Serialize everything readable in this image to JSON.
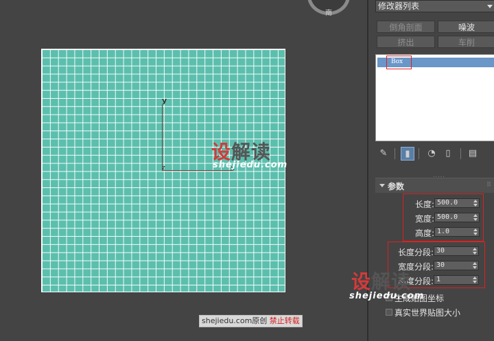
{
  "viewport": {
    "viewcube_label": "南",
    "gizmo": {
      "x": "x",
      "y": "y",
      "z": "z"
    },
    "watermark": {
      "cn": [
        "设",
        "解读"
      ],
      "en": "shejiedu.com"
    },
    "credit": {
      "site": "shejiedu.com",
      "text": "原创",
      "warning": "禁止转载"
    }
  },
  "panel": {
    "modifier_list": "修改器列表",
    "quick_buttons": [
      {
        "label": "倒角剖面",
        "enabled": false
      },
      {
        "label": "噪波",
        "enabled": true
      },
      {
        "label": "挤出",
        "enabled": false
      },
      {
        "label": "车削",
        "enabled": false
      }
    ],
    "stack": {
      "selected_item": "Box"
    },
    "toolbar_icons": [
      "pin-stack-icon",
      "show-end-result-icon",
      "make-unique-icon",
      "remove-modifier-icon",
      "configure-modifier-sets-icon"
    ],
    "parameters": {
      "title": "参数",
      "length_label": "长度:",
      "length": "500.0",
      "width_label": "宽度:",
      "width": "500.0",
      "height_label": "高度:",
      "height": "1.0",
      "length_segs_label": "长度分段:",
      "length_segs": "30",
      "width_segs_label": "宽度分段:",
      "width_segs": "30",
      "height_segs_label": "高度分段:",
      "height_segs": "1",
      "gen_map_coords": "生成贴图坐标",
      "gen_map_coords_checked": true,
      "real_world_map_size": "真实世界贴图大小",
      "real_world_map_size_checked": false
    },
    "watermark": {
      "cn": [
        "设",
        "解读"
      ],
      "en": "shejiedu.com"
    }
  },
  "colors": {
    "plane": "#5cbfae",
    "selection_blue": "#6a96c8",
    "highlight_red": "#e02020",
    "watermark_red": "#d43a3a"
  }
}
